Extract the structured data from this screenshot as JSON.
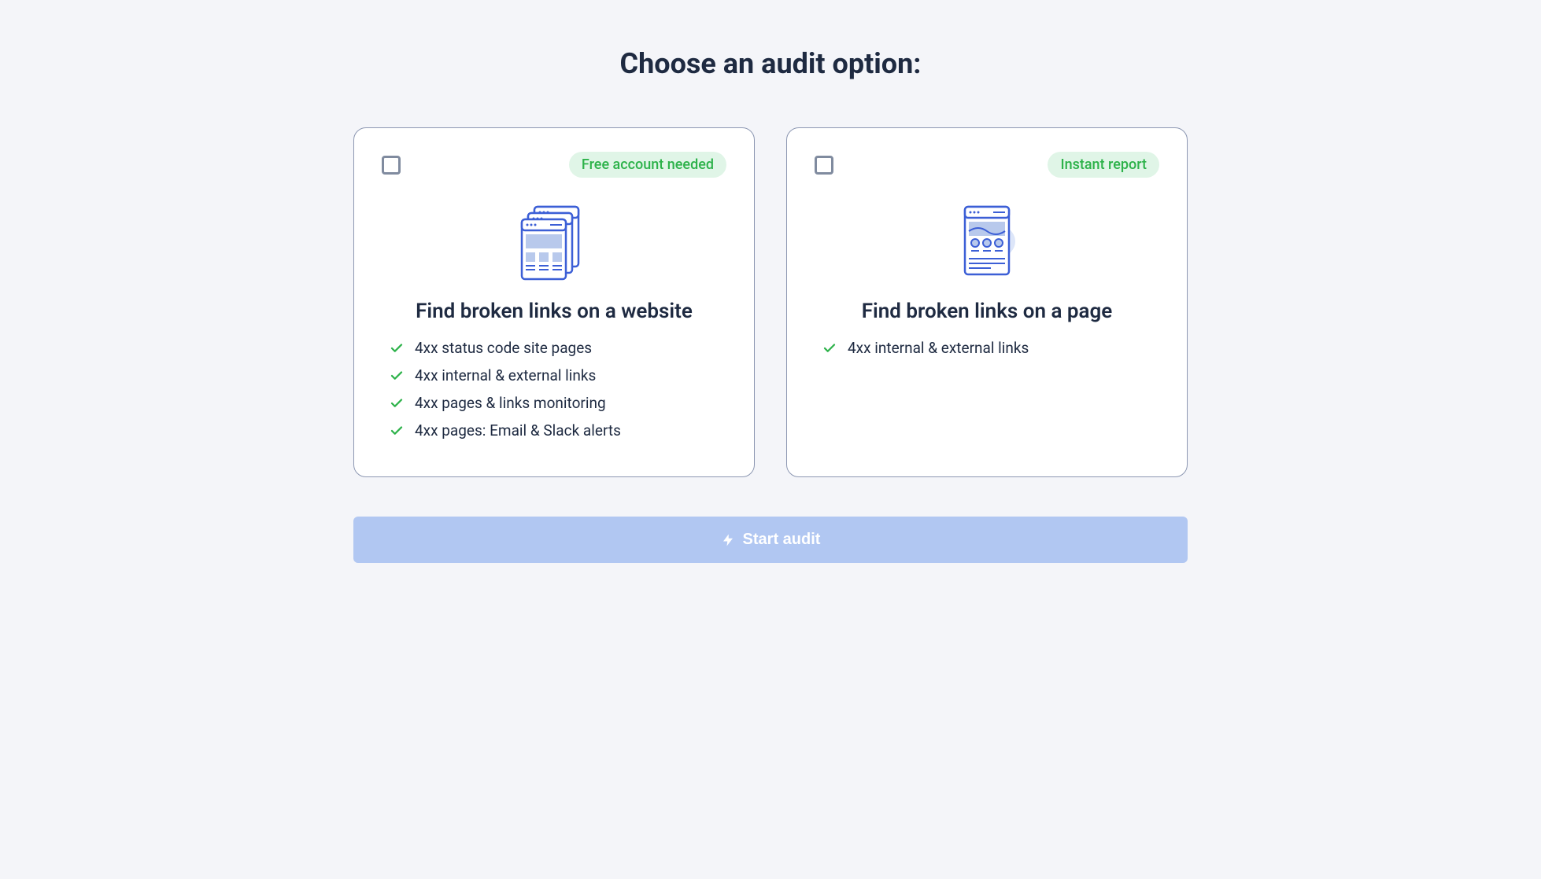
{
  "title": "Choose an audit option:",
  "cards": [
    {
      "badge": "Free account needed",
      "title": "Find broken links on a website",
      "features": [
        "4xx status code site pages",
        "4xx internal & external links",
        "4xx pages & links monitoring",
        "4xx pages: Email & Slack alerts"
      ]
    },
    {
      "badge": "Instant report",
      "title": "Find broken links on a page",
      "features": [
        "4xx internal & external links"
      ]
    }
  ],
  "button": "Start audit"
}
